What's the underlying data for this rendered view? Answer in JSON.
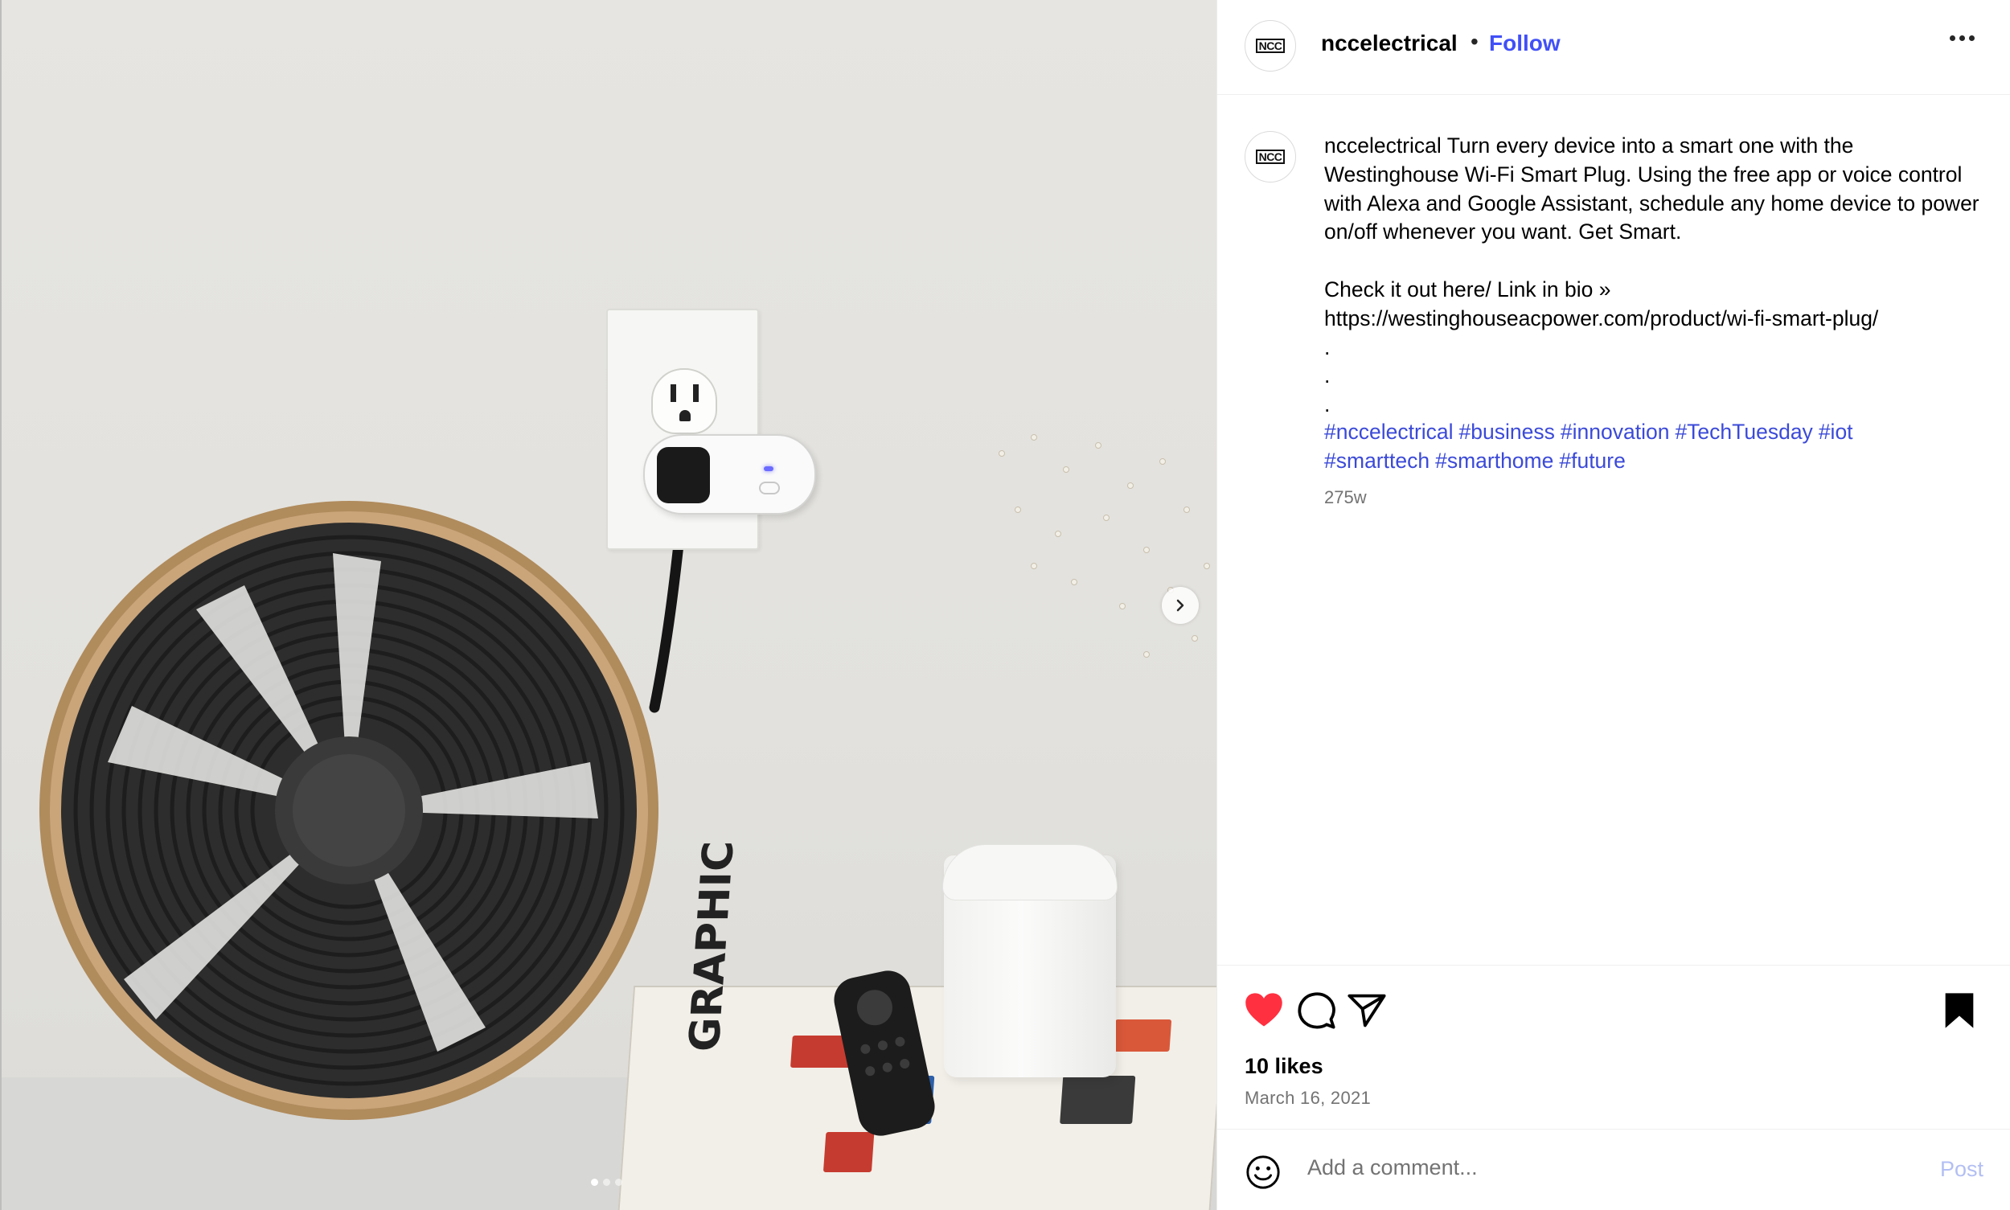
{
  "post": {
    "username": "nccelectrical",
    "separator": "•",
    "follow_label": "Follow",
    "avatar_logo_text": "NCC",
    "caption_username": "nccelectrical",
    "caption_text": " Turn every device into a smart one with the Westinghouse Wi-Fi Smart Plug. Using the free app or voice control with Alexa and Google Assistant, schedule any home device to power on/off whenever you want. Get Smart.\n\nCheck it out here/ Link in bio »\nhttps://westinghouseacpower.com/product/wi-fi-smart-plug/\n.\n.\n.",
    "hashtags": [
      "#nccelectrical",
      "#business",
      "#innovation",
      "#TechTuesday",
      "#iot",
      "#smarttech",
      "#smarthome",
      "#future"
    ],
    "age": "275w",
    "likes": "10 likes",
    "date": "March 16, 2021",
    "liked": true,
    "saved": true
  },
  "comment": {
    "placeholder": "Add a comment...",
    "post_label": "Post"
  },
  "photo": {
    "book_title": "GRAPHIC",
    "carousel": {
      "count": 3,
      "active_index": 0
    }
  },
  "icons": {
    "like": "heart-icon",
    "comment": "comment-bubble-icon",
    "share": "paper-plane-icon",
    "save": "bookmark-icon",
    "more": "more-options-icon",
    "emoji": "emoji-smiley-icon",
    "next": "chevron-right-icon"
  },
  "colors": {
    "accent": "#4150f7",
    "hashtag": "#3b4ad8",
    "heart": "#ff3040",
    "muted": "#737373",
    "post_disabled": "#b3bff3"
  }
}
